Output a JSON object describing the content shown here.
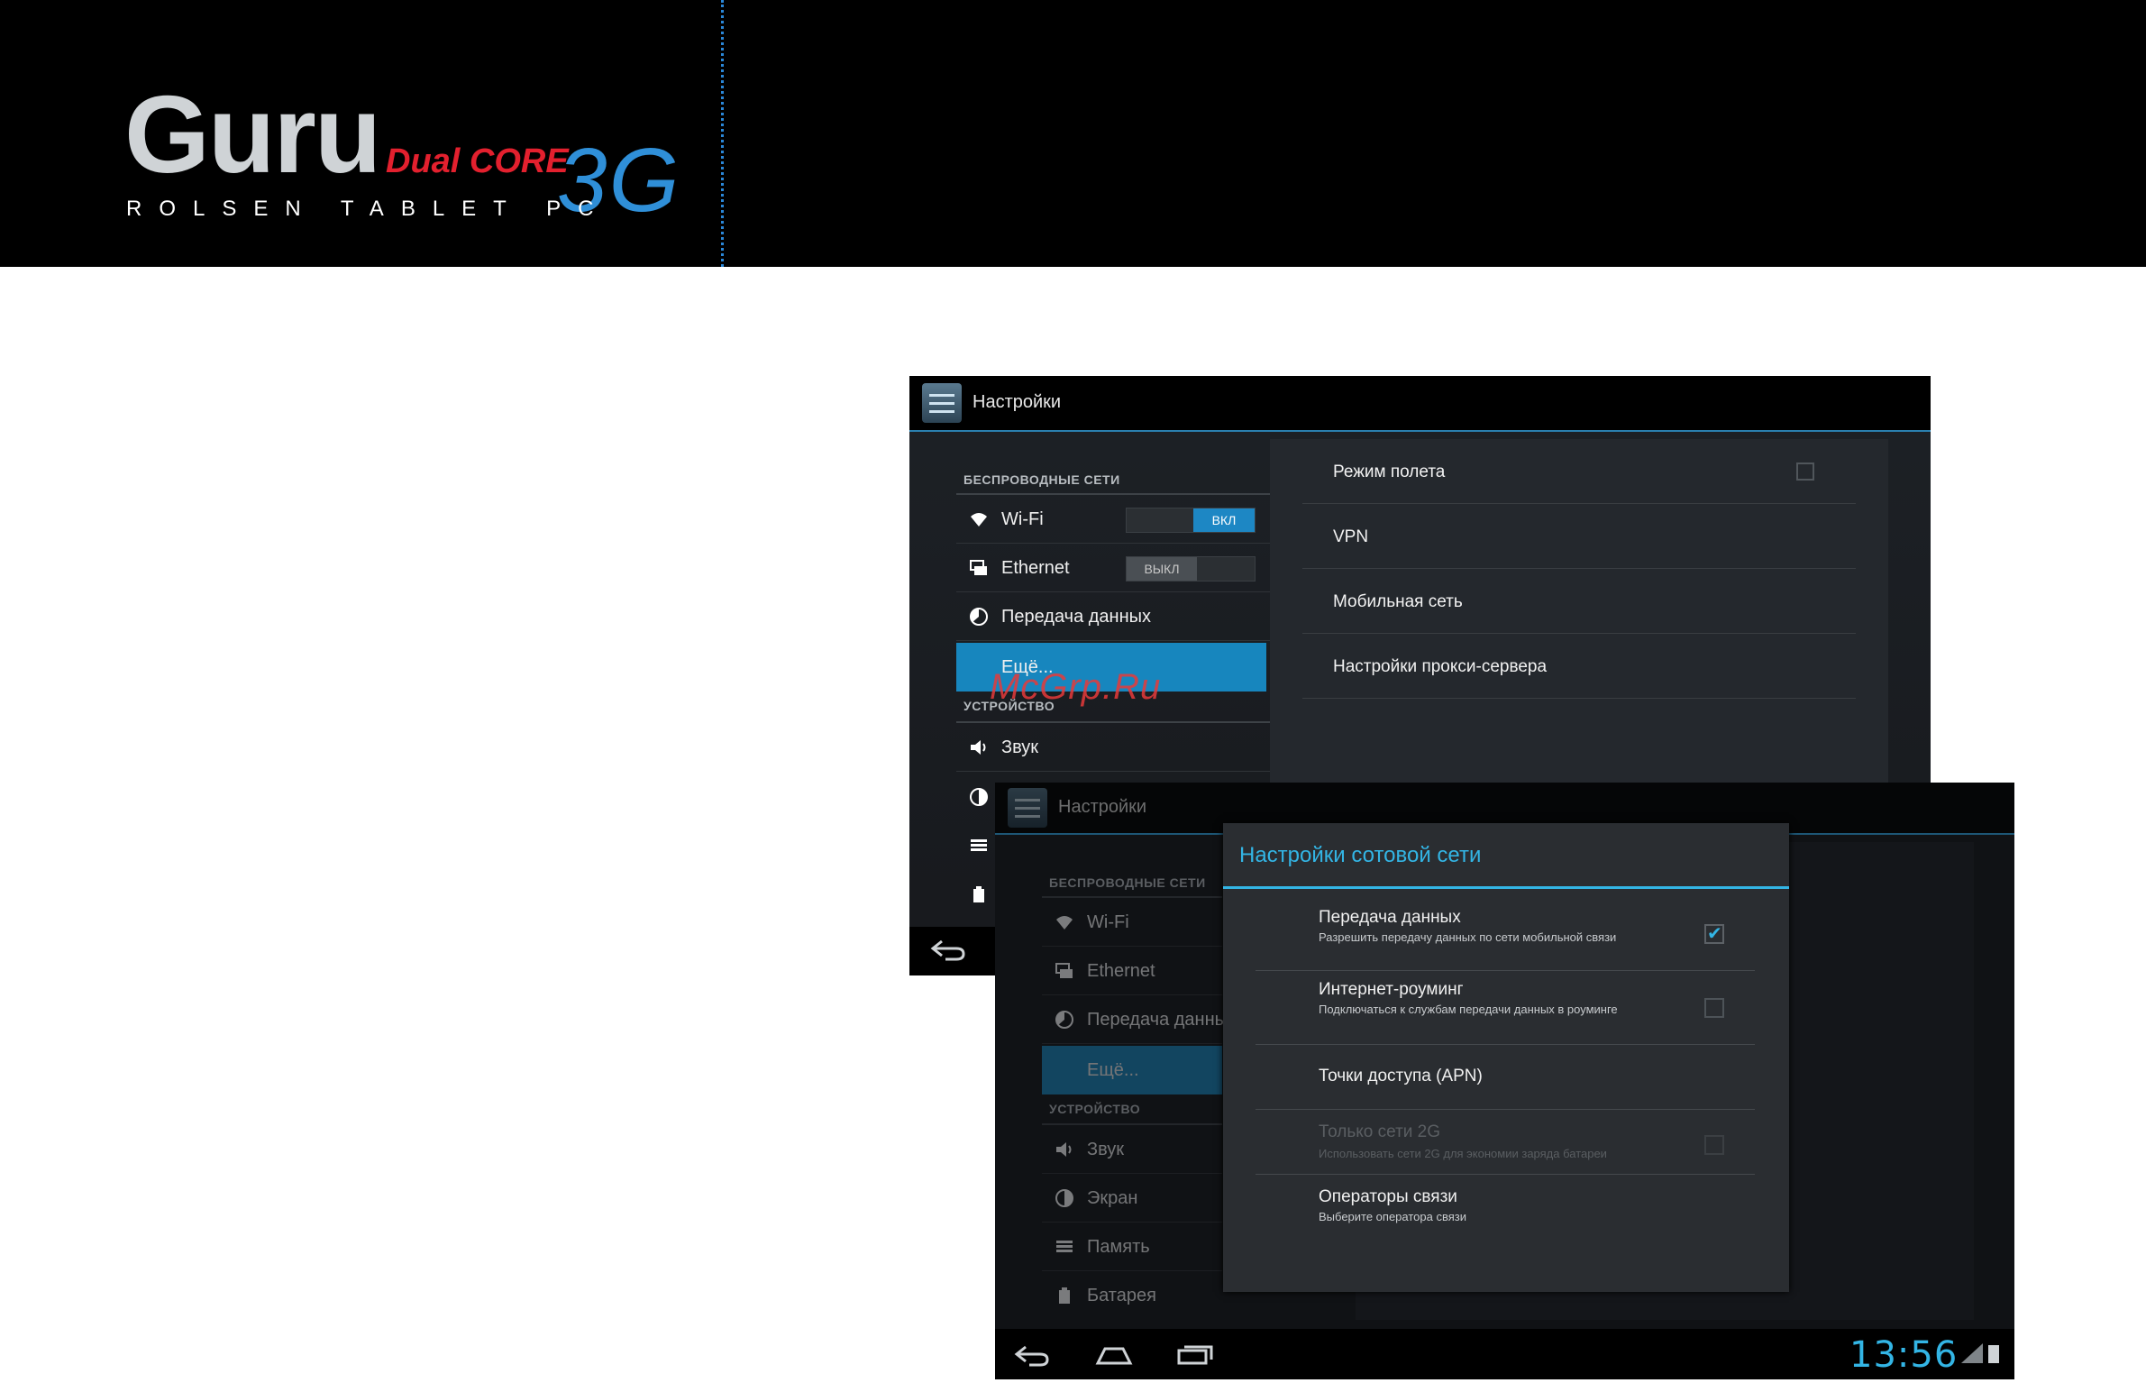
{
  "brand": {
    "name": "Guru",
    "edition": "Dual CORE",
    "network": "3G",
    "tagline": "ROLSEN TABLET PC",
    "colors": {
      "accent_blue": "#2f8fd8",
      "accent_red": "#e3202e"
    }
  },
  "watermark": "McGrp.Ru",
  "settings_screen": {
    "title": "Настройки",
    "app_icon": "settings-sliders-icon",
    "wireless_header": "БЕСПРОВОДНЫЕ СЕТИ",
    "device_header": "УСТРОЙСТВО",
    "wireless_items": [
      {
        "label": "Wi-Fi",
        "icon": "wifi-icon",
        "toggle": "ВКЛ"
      },
      {
        "label": "Ethernet",
        "icon": "ethernet-icon",
        "toggle": "ВЫКЛ"
      },
      {
        "label": "Передача данных",
        "icon": "data-usage-icon"
      },
      {
        "label": "Ещё...",
        "selected": true
      }
    ],
    "device_items": [
      {
        "label": "Звук",
        "icon": "sound-icon"
      }
    ],
    "more_panel": [
      {
        "label": "Режим полета",
        "checkbox": false
      },
      {
        "label": "VPN"
      },
      {
        "label": "Мобильная сеть"
      },
      {
        "label": "Настройки прокси-сервера"
      }
    ],
    "nav_back_icon": "back-icon"
  },
  "mobile_network_screen": {
    "title": "Настройки",
    "wireless_header": "БЕСПРОВОДНЫЕ СЕТИ",
    "device_header": "УСТРОЙСТВО",
    "wireless_items": [
      {
        "label": "Wi-Fi"
      },
      {
        "label": "Ethernet"
      },
      {
        "label": "Передача данных"
      },
      {
        "label": "Ещё..."
      }
    ],
    "device_items": [
      {
        "label": "Звук"
      },
      {
        "label": "Экран"
      },
      {
        "label": "Память"
      },
      {
        "label": "Батарея"
      }
    ],
    "dialog": {
      "title": "Настройки сотовой сети",
      "rows": [
        {
          "title": "Передача данных",
          "summary": "Разрешить передачу данных по сети мобильной связи",
          "checked": true
        },
        {
          "title": "Интернет-роуминг",
          "summary": "Подключаться к службам передачи данных в роуминге",
          "checked": false
        },
        {
          "title": "Точки доступа (APN)"
        },
        {
          "title": "Только сети 2G",
          "summary": "Использовать сети 2G для экономии заряда батареи",
          "checked": false,
          "disabled": true
        },
        {
          "title": "Операторы связи",
          "summary": "Выберите оператора связи"
        }
      ]
    },
    "status": {
      "time": "13:56"
    }
  }
}
